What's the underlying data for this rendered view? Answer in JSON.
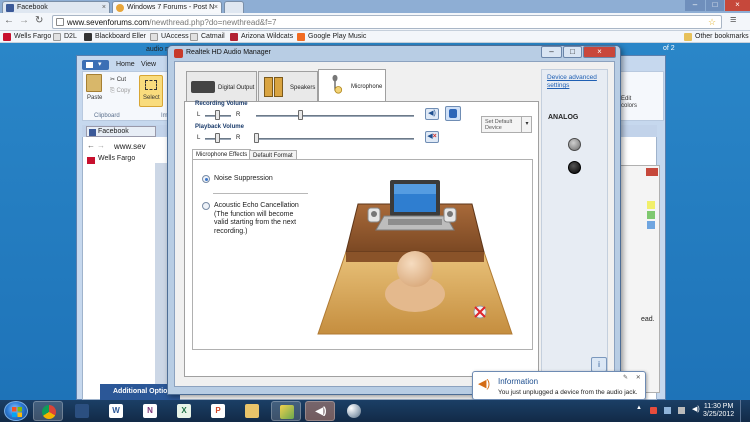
{
  "browser": {
    "tabs": [
      {
        "label": "Facebook"
      },
      {
        "label": "Windows 7 Forums - Post N"
      }
    ],
    "url_domain": "www.sevenforums.com",
    "url_path": "/newthread.php?do=newthread&f=7",
    "bookmarks": [
      "Wells Fargo",
      "D2L",
      "Blackboard Eller",
      "UAccess",
      "Catmail",
      "Arizona Wildcats",
      "Google Play Music"
    ],
    "other_bookmarks": "Other bookmarks",
    "pager": "of 2"
  },
  "paint": {
    "tab_home": "Home",
    "tab_view": "View",
    "paste": "Paste",
    "cut": "Cut",
    "copy": "Copy",
    "select": "Select",
    "clipboard": "Clipboard",
    "image_group": "Im",
    "edit_colors": "Edit colors",
    "doc_title": "audio m"
  },
  "inner_browser": {
    "tab": "Facebook",
    "url": "www.sev",
    "bookmark": "Wells Fargo",
    "footer": "Additional Optio",
    "read_snippet": "ead."
  },
  "realtek": {
    "title": "Realtek HD Audio Manager",
    "tabs": [
      "Digital Output",
      "Speakers",
      "Microphone"
    ],
    "recording_volume": "Recording Volume",
    "playback_volume": "Playback Volume",
    "left": "L",
    "right": "R",
    "recording_level": 0.28,
    "playback_level": 0.0,
    "set_default": "Set Default Device",
    "subtabs": [
      "Microphone Effects",
      "Default Format"
    ],
    "noise_suppression": "Noise Suppression",
    "echo_cancel_line1": "Acoustic Echo Cancellation",
    "echo_cancel_line2": "(The function will become",
    "echo_cancel_line3": "valid starting from the next",
    "echo_cancel_line4": "recording.)",
    "device_advanced": "Device advanced",
    "device_advanced2": "settings",
    "analog": "ANALOG",
    "info_glyph": "i"
  },
  "notification": {
    "title": "Information",
    "message": "You just unplugged a device from the audio jack."
  },
  "taskbar": {
    "time": "11:30 PM",
    "date": "3/25/2012",
    "apps": [
      "W",
      "N",
      "X",
      "P"
    ]
  },
  "colors": {
    "desktop": "#1e73b8",
    "taskbar": "#122a47",
    "accent": "#1f5fb3"
  }
}
